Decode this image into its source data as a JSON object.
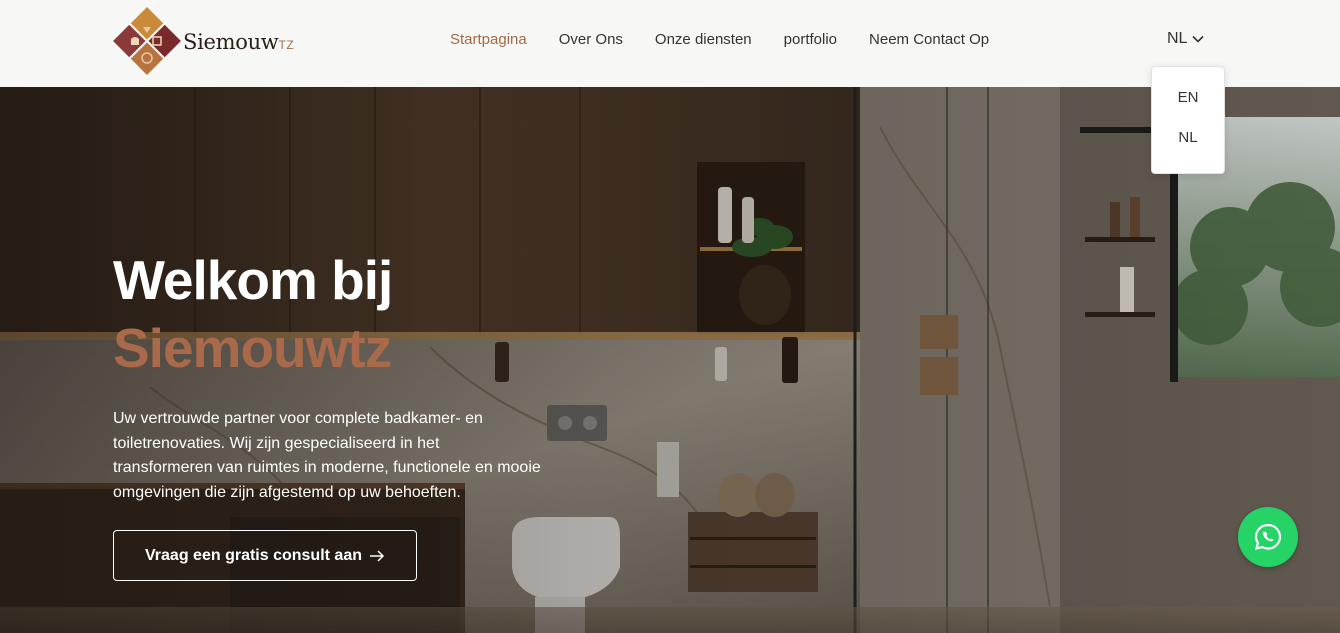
{
  "brand": {
    "name_main": "Siemouw",
    "name_suffix": "TZ"
  },
  "nav": {
    "items": [
      {
        "label": "Startpagina",
        "active": true
      },
      {
        "label": "Over Ons",
        "active": false
      },
      {
        "label": "Onze diensten",
        "active": false
      },
      {
        "label": "portfolio",
        "active": false
      },
      {
        "label": "Neem Contact Op",
        "active": false
      }
    ]
  },
  "language": {
    "current": "NL",
    "options": [
      "EN",
      "NL"
    ]
  },
  "hero": {
    "title": "Welkom bij",
    "brand": "Siemouwtz",
    "description": "Uw vertrouwde partner voor complete badkamer- en toiletrenovaties. Wij zijn gespecialiseerd in het transformeren van ruimtes in moderne, functionele en mooie omgevingen die zijn afgestemd op uw behoeften.",
    "cta_label": "Vraag een gratis consult aan"
  },
  "colors": {
    "accent": "#a26a44",
    "brand_text": "#a86a4a",
    "whatsapp": "#25d366",
    "header_bg": "#f7f7f6"
  },
  "icons": {
    "language_toggle": "chevron-down-icon",
    "cta": "arrow-right-icon",
    "chat": "whatsapp-icon"
  }
}
